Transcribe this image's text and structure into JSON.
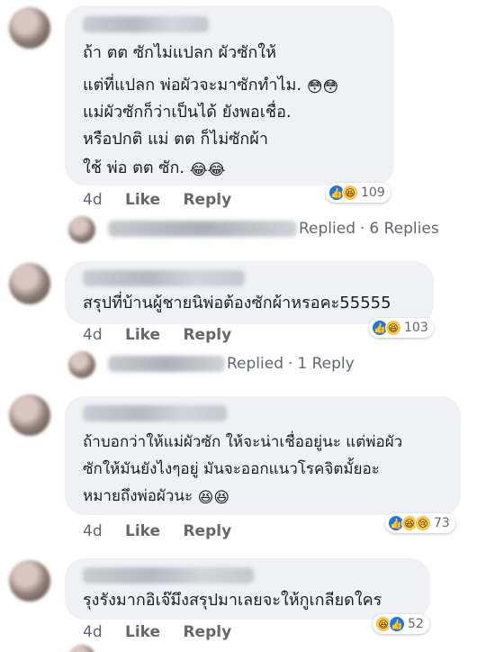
{
  "comments": [
    {
      "lines": [
        "ถ้า ตต ซักไม่แปลก ผัวซักให้",
        "แต่ที่แปลก พ่อผัวจะมาซักทำไม.",
        "แม่ผัวซักก็ว่าเป็นได้ ยังพอเชื่อ.",
        "หรือปกติ แม่ ตต ก็ไม่ซักผ้า",
        "ใช้ พ่อ ตต ซัก."
      ],
      "emojis": {
        "line2": "😳😳",
        "line5": "😂😂"
      },
      "time": "4d",
      "like_label": "Like",
      "reply_label": "Reply",
      "reaction_count": "109",
      "replies": {
        "label": "Replied",
        "sep": "·",
        "count": "6 Replies"
      }
    },
    {
      "lines": [
        "สรุปที่บ้านผู้ชายนิพ่อต้องซักผ้าหรอคะ55555"
      ],
      "time": "4d",
      "like_label": "Like",
      "reply_label": "Reply",
      "reaction_count": "103",
      "replies": {
        "label": "Replied",
        "sep": "·",
        "count": "1 Reply"
      }
    },
    {
      "lines": [
        "ถ้าบอกว่าให้แม่ผัวซัก ให้จะน่าเชื่ออยู่นะ แต่พ่อผัว",
        "ซักให้มันยังไงๆอยู่ มันจะออกแนวโรคจิตมั้ยอะ",
        "หมายถึงพ่อผัวนะ"
      ],
      "emojis": {
        "line3": "😆😆"
      },
      "time": "4d",
      "like_label": "Like",
      "reply_label": "Reply",
      "reaction_count": "73"
    },
    {
      "lines": [
        "รุงรังมากอิเจ๊มึงสรุปมาเลยจะให้กูเกลียดใคร"
      ],
      "time": "4d",
      "like_label": "Like",
      "reply_label": "Reply",
      "reaction_count": "52"
    }
  ],
  "colors": {
    "bubble": "#eff1f4",
    "meta": "#606770",
    "like_blue": "#1877f2",
    "haha_yellow": "#f7c64a"
  },
  "icons": [
    "like-icon",
    "haha-icon",
    "sad-icon"
  ]
}
